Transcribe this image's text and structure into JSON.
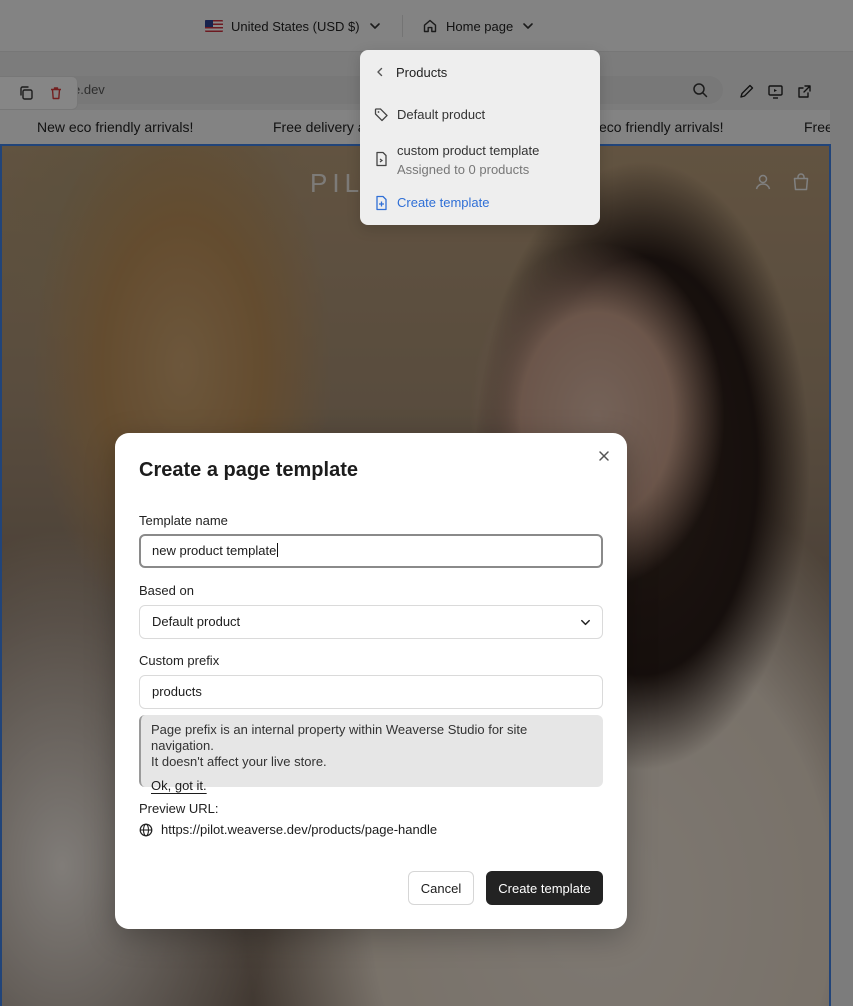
{
  "topbar": {
    "country": "United States (USD $)",
    "page": "Home page"
  },
  "preview": {
    "url": "e.dev",
    "announcements": [
      "New eco friendly arrivals!",
      "Free delivery a",
      "eco friendly arrivals!",
      "Free"
    ],
    "store_logo": "PILO"
  },
  "dropdown": {
    "back_label": "Products",
    "items": [
      {
        "label": "Default product",
        "sub": ""
      },
      {
        "label": "custom product template",
        "sub": "Assigned to 0 products"
      }
    ],
    "create_label": "Create template"
  },
  "modal": {
    "title": "Create a page template",
    "template_name_label": "Template name",
    "template_name_value": "new product template",
    "based_on_label": "Based on",
    "based_on_value": "Default product",
    "prefix_label": "Custom prefix",
    "prefix_value": "products",
    "info_text_1": "Page prefix is an internal property within Weaverse Studio for site navigation.",
    "info_text_2": "It doesn't affect your live store.",
    "info_link": "Ok, got it.",
    "preview_label": "Preview URL:",
    "preview_url": "https://pilot.weaverse.dev/products/page-handle",
    "cancel_label": "Cancel",
    "create_label": "Create template"
  },
  "colors": {
    "accent_blue": "#2f6fd6",
    "primary_button": "#232323",
    "selection_border": "#3d7fe0"
  },
  "icons": [
    "us-flag-icon",
    "chevron-down-icon",
    "home-icon",
    "copy-icon",
    "trash-icon",
    "search-icon",
    "edit-icon",
    "preview-icon",
    "external-link-icon",
    "user-icon",
    "bag-icon",
    "chevron-left-icon",
    "tag-icon",
    "file-icon",
    "file-plus-icon",
    "close-icon",
    "globe-icon"
  ]
}
